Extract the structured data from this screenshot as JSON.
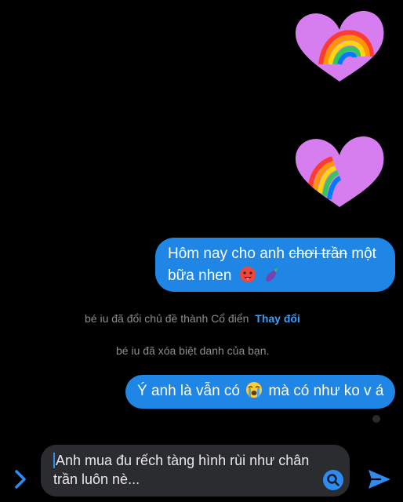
{
  "stickers": [
    {
      "name": "rainbow-heart-sticker",
      "icon": "heart-with-rainbow",
      "color": "#d67ef0"
    },
    {
      "name": "rainbow-heart-sticker",
      "icon": "heart-with-rainbow",
      "color": "#d67ef0"
    }
  ],
  "messages": [
    {
      "sender": "me",
      "text_before": "Hôm nay cho anh",
      "text_strike": "chơi trần",
      "text_after": "một bữa nhen",
      "emojis": [
        "hot-face-emoji",
        "eggplant-emoji"
      ]
    },
    {
      "sender": "me",
      "text_before": "Ý anh là vẫn có",
      "text_after": "mà có như ko v á",
      "emojis": [
        "loudly-crying-face-emoji"
      ]
    }
  ],
  "system_messages": [
    {
      "text": "bé iu đã đổi chủ đề thành Cổ điển",
      "link": "Thay đổi"
    },
    {
      "text": "bé iu đã xóa biệt danh của bạn."
    }
  ],
  "composer": {
    "text": "Anh mua đu rếch tàng hình rùi như chân trần luôn nè..."
  },
  "colors": {
    "bubble": "#1f86e6",
    "link": "#3e9cf5",
    "system_text": "#8b8d92",
    "accent": "#2e8cf0"
  }
}
